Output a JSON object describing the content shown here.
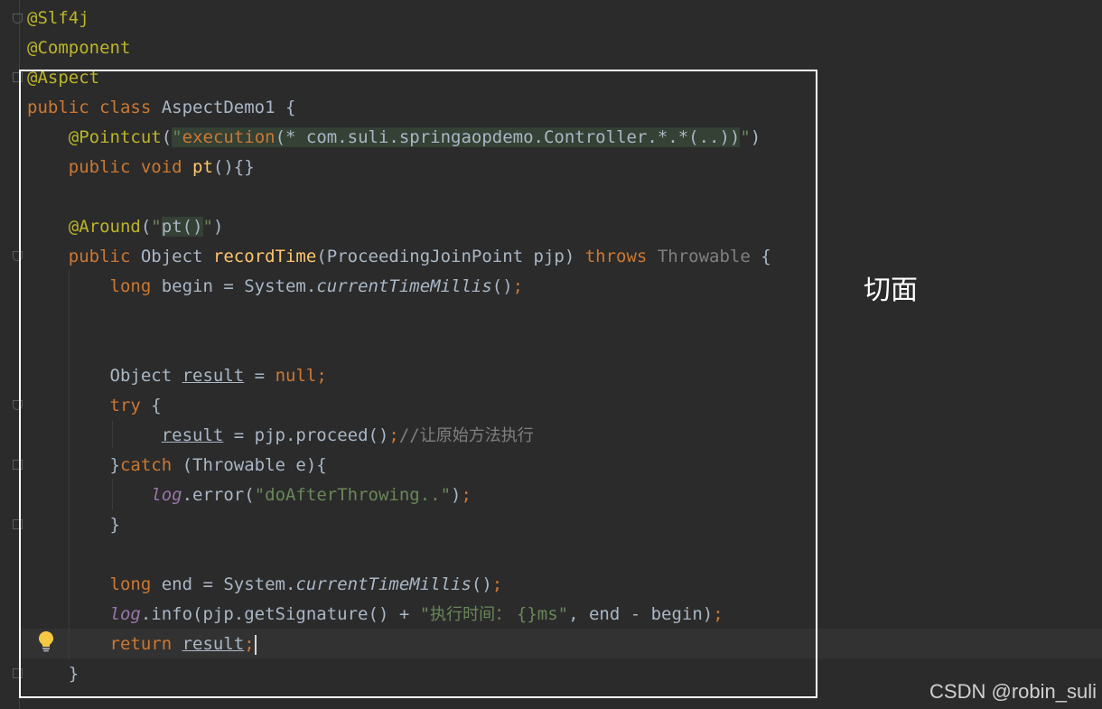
{
  "editor": {
    "lines": [
      {
        "parts": [
          {
            "t": "@Slf4j",
            "c": "ann"
          }
        ]
      },
      {
        "parts": [
          {
            "t": "@Component",
            "c": "ann"
          }
        ]
      },
      {
        "parts": [
          {
            "t": "@Aspect",
            "c": "ann"
          }
        ]
      },
      {
        "parts": [
          {
            "t": "public class ",
            "c": "kw"
          },
          {
            "t": "AspectDemo1 {",
            "c": ""
          }
        ]
      },
      {
        "parts": [
          {
            "t": "    @Pointcut",
            "c": "ann"
          },
          {
            "t": "(",
            "c": ""
          },
          {
            "t": "\"",
            "c": "str hl"
          },
          {
            "t": "execution",
            "c": "kw hl"
          },
          {
            "t": "(* com.suli.springaopdemo.Controller.*.*(..))",
            "c": "hl"
          },
          {
            "t": "\"",
            "c": "str"
          },
          {
            "t": ")",
            "c": ""
          }
        ]
      },
      {
        "parts": [
          {
            "t": "    public void ",
            "c": "kw"
          },
          {
            "t": "pt",
            "c": "fn"
          },
          {
            "t": "(){}",
            "c": ""
          }
        ]
      },
      {
        "parts": [
          {
            "t": "",
            "c": ""
          }
        ]
      },
      {
        "parts": [
          {
            "t": "    @Around",
            "c": "ann"
          },
          {
            "t": "(",
            "c": ""
          },
          {
            "t": "\"",
            "c": "str"
          },
          {
            "t": "pt()",
            "c": "hl"
          },
          {
            "t": "\"",
            "c": "str"
          },
          {
            "t": ")",
            "c": ""
          }
        ]
      },
      {
        "parts": [
          {
            "t": "    public ",
            "c": "kw"
          },
          {
            "t": "Object ",
            "c": ""
          },
          {
            "t": "recordTime",
            "c": "fn"
          },
          {
            "t": "(ProceedingJoinPoint pjp) ",
            "c": ""
          },
          {
            "t": "throws ",
            "c": "kw"
          },
          {
            "t": "Throwable",
            "c": "grey"
          },
          {
            "t": " {",
            "c": ""
          }
        ]
      },
      {
        "parts": [
          {
            "t": "        long ",
            "c": "kw"
          },
          {
            "t": "begin = System.",
            "c": ""
          },
          {
            "t": "currentTimeMillis",
            "c": "ital"
          },
          {
            "t": "()",
            "c": ""
          },
          {
            "t": ";",
            "c": "kw"
          }
        ]
      },
      {
        "parts": [
          {
            "t": "",
            "c": ""
          }
        ]
      },
      {
        "parts": [
          {
            "t": "",
            "c": ""
          }
        ]
      },
      {
        "parts": [
          {
            "t": "        Object ",
            "c": ""
          },
          {
            "t": "result",
            "c": "ul"
          },
          {
            "t": " = ",
            "c": ""
          },
          {
            "t": "null;",
            "c": "kw"
          }
        ]
      },
      {
        "parts": [
          {
            "t": "        try ",
            "c": "kw"
          },
          {
            "t": "{",
            "c": ""
          }
        ]
      },
      {
        "parts": [
          {
            "t": "             ",
            "c": ""
          },
          {
            "t": "result",
            "c": "ul"
          },
          {
            "t": " = pjp.proceed()",
            "c": ""
          },
          {
            "t": ";",
            "c": "kw"
          },
          {
            "t": "//",
            "c": "grey"
          },
          {
            "t": "让原始方法执行",
            "c": "cmt"
          }
        ]
      },
      {
        "parts": [
          {
            "t": "        }",
            "c": ""
          },
          {
            "t": "catch ",
            "c": "kw"
          },
          {
            "t": "(Throwable e){",
            "c": ""
          }
        ]
      },
      {
        "parts": [
          {
            "t": "            ",
            "c": ""
          },
          {
            "t": "log",
            "c": "field ital"
          },
          {
            "t": ".error(",
            "c": ""
          },
          {
            "t": "\"doAfterThrowing..\"",
            "c": "str"
          },
          {
            "t": ")",
            "c": ""
          },
          {
            "t": ";",
            "c": "kw"
          }
        ]
      },
      {
        "parts": [
          {
            "t": "        }",
            "c": ""
          }
        ]
      },
      {
        "parts": [
          {
            "t": "",
            "c": ""
          }
        ]
      },
      {
        "parts": [
          {
            "t": "        long ",
            "c": "kw"
          },
          {
            "t": "end = System.",
            "c": ""
          },
          {
            "t": "currentTimeMillis",
            "c": "ital"
          },
          {
            "t": "()",
            "c": ""
          },
          {
            "t": ";",
            "c": "kw"
          }
        ]
      },
      {
        "parts": [
          {
            "t": "        ",
            "c": ""
          },
          {
            "t": "log",
            "c": "field ital"
          },
          {
            "t": ".info(pjp.getSignature() + ",
            "c": ""
          },
          {
            "t": "\"",
            "c": "str"
          },
          {
            "t": "执行时间： ",
            "c": "str cjk"
          },
          {
            "t": "{}ms\"",
            "c": "str"
          },
          {
            "t": ", end - begin)",
            "c": ""
          },
          {
            "t": ";",
            "c": "kw"
          }
        ]
      },
      {
        "parts": [
          {
            "t": "        return ",
            "c": "kw"
          },
          {
            "t": "result",
            "c": "ul"
          },
          {
            "t": ";",
            "c": "kw"
          },
          {
            "t": "",
            "c": "caret"
          }
        ]
      },
      {
        "parts": [
          {
            "t": "    }",
            "c": ""
          }
        ]
      }
    ]
  },
  "annotation": {
    "label": "切面"
  },
  "watermark": "CSDN @robin_suli",
  "icons": {
    "hint": "lightbulb-icon"
  }
}
